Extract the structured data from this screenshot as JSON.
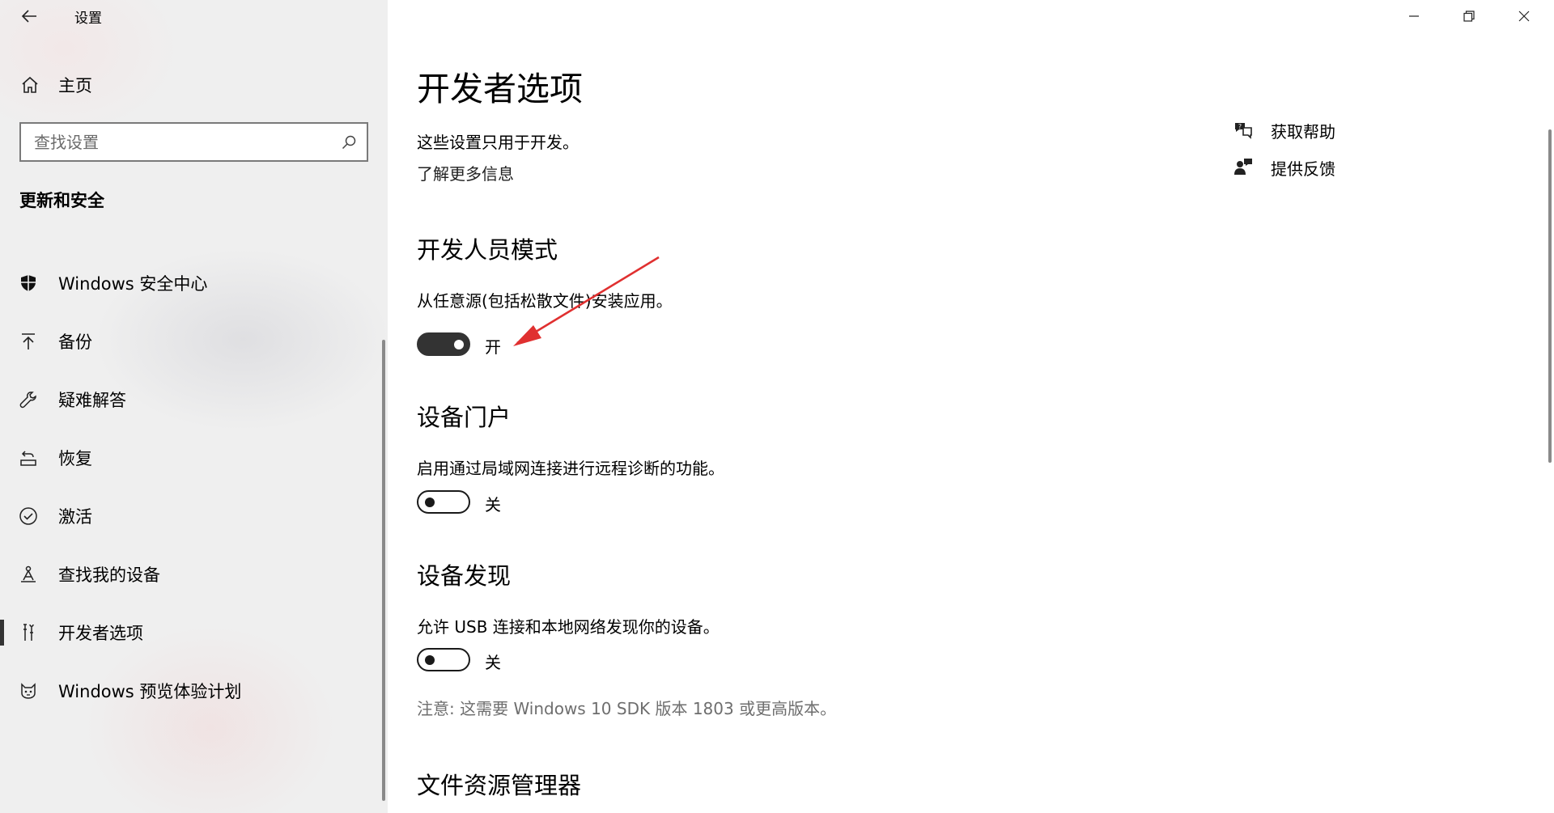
{
  "window": {
    "title": "设置",
    "controls": [
      "minimize-icon",
      "restore-icon",
      "close-icon"
    ]
  },
  "sidebar": {
    "home_label": "主页",
    "search": {
      "placeholder": "查找设置",
      "value": ""
    },
    "section_title": "更新和安全",
    "items": [
      {
        "label": "Windows 安全中心",
        "icon": "shield-icon",
        "active": false
      },
      {
        "label": "备份",
        "icon": "backup-arrow-icon",
        "active": false
      },
      {
        "label": "疑难解答",
        "icon": "wrench-icon",
        "active": false
      },
      {
        "label": "恢复",
        "icon": "recovery-icon",
        "active": false
      },
      {
        "label": "激活",
        "icon": "checkmark-circle-icon",
        "active": false
      },
      {
        "label": "查找我的设备",
        "icon": "find-device-icon",
        "active": false
      },
      {
        "label": "开发者选项",
        "icon": "developer-tools-icon",
        "active": true
      },
      {
        "label": "Windows 预览体验计划",
        "icon": "insider-cat-icon",
        "active": false
      }
    ]
  },
  "main": {
    "title": "开发者选项",
    "intro": "这些设置只用于开发。",
    "learn_more": "了解更多信息",
    "sections": [
      {
        "heading": "开发人员模式",
        "description": "从任意源(包括松散文件)安装应用。",
        "toggle_state": true,
        "toggle_label": "开"
      },
      {
        "heading": "设备门户",
        "description": "启用通过局域网连接进行远程诊断的功能。",
        "toggle_state": false,
        "toggle_label": "关"
      },
      {
        "heading": "设备发现",
        "description": "允许 USB 连接和本地网络发现你的设备。",
        "toggle_state": false,
        "toggle_label": "关"
      }
    ],
    "note": "注意: 这需要 Windows 10 SDK 版本 1803 或更高版本。",
    "file_explorer_heading": "文件资源管理器",
    "help": {
      "get_help": "获取帮助",
      "feedback": "提供反馈"
    }
  },
  "annotation": {
    "arrow_color": "#e03030"
  }
}
